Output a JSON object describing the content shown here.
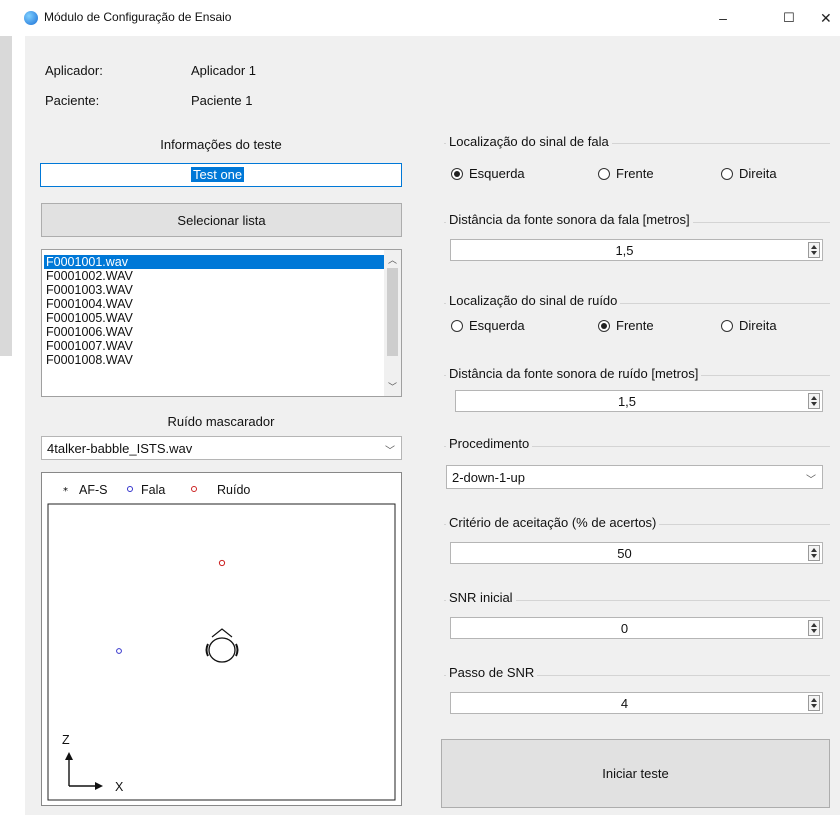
{
  "window": {
    "title": "Módulo de Configuração de Ensaio",
    "minimize": "–",
    "maximize": "☐",
    "close": "✕"
  },
  "header": {
    "applicator_label": "Aplicador:",
    "applicator_value": "Aplicador 1",
    "patient_label": "Paciente:",
    "patient_value": "Paciente 1"
  },
  "left": {
    "test_info_label": "Informações do teste",
    "test_name": "Test one",
    "select_list_button": "Selecionar lista",
    "files": [
      "F0001001.wav",
      "F0001002.WAV",
      "F0001003.WAV",
      "F0001004.WAV",
      "F0001005.WAV",
      "F0001006.WAV",
      "F0001007.WAV",
      "F0001008.WAV"
    ],
    "selected_file": "F0001001.wav",
    "masker_label": "Ruído mascarador",
    "masker_value": "4talker-babble_ISTS.wav",
    "plot": {
      "legend": [
        {
          "marker": "*",
          "label": "AF-S",
          "color": "#000000"
        },
        {
          "marker": "o",
          "label": "Fala",
          "color": "#3333cc"
        },
        {
          "marker": "o",
          "label": "Ruído",
          "color": "#cc2222"
        }
      ],
      "z_label": "Z",
      "x_label": "X"
    }
  },
  "right": {
    "speech_location": {
      "title": "Localização do sinal de fala",
      "options": [
        "Esquerda",
        "Frente",
        "Direita"
      ],
      "selected": "Esquerda"
    },
    "speech_distance": {
      "title": "Distância da fonte sonora da fala [metros]",
      "value": "1,5"
    },
    "noise_location": {
      "title": "Localização do sinal de ruído",
      "options": [
        "Esquerda",
        "Frente",
        "Direita"
      ],
      "selected": "Frente"
    },
    "noise_distance": {
      "title": "Distância da fonte sonora de ruído [metros]",
      "value": "1,5"
    },
    "procedure": {
      "title": "Procedimento",
      "value": "2-down-1-up"
    },
    "acceptance": {
      "title": "Critério de aceitação (% de acertos)",
      "value": "50"
    },
    "snr_initial": {
      "title": "SNR inicial",
      "value": "0"
    },
    "snr_step": {
      "title": "Passo de SNR",
      "value": "4"
    },
    "start_button": "Iniciar teste"
  }
}
